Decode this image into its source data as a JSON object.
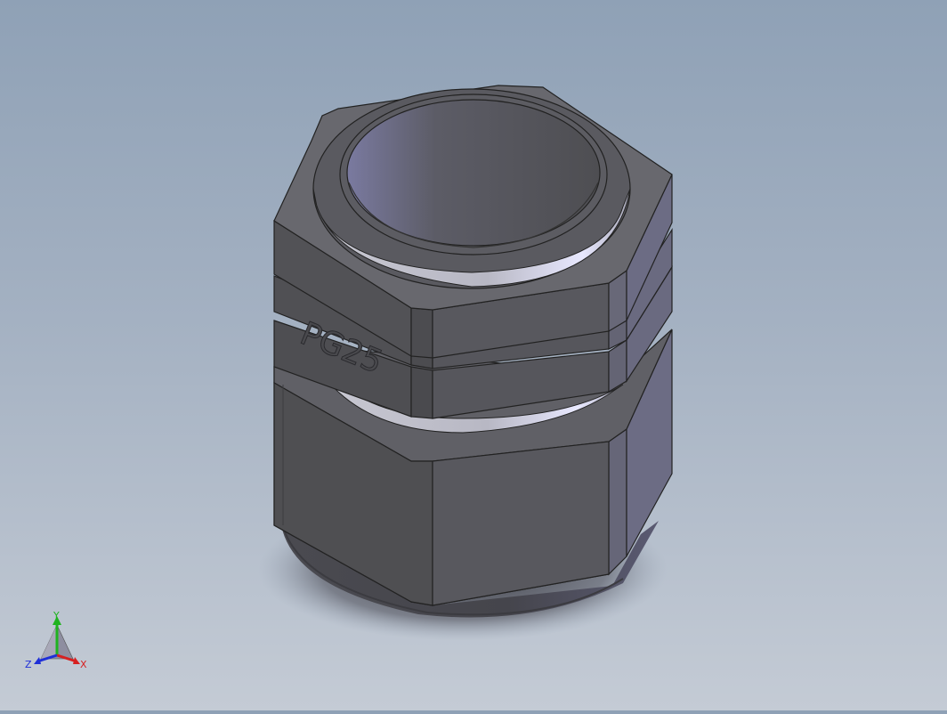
{
  "model": {
    "engraved_text": "PG25"
  },
  "triad": {
    "x_label": "X",
    "y_label": "Y",
    "z_label": "Z",
    "x_color": "#d62020",
    "y_color": "#1fb31f",
    "z_color": "#1e2fd8"
  },
  "colors": {
    "body_dark": "#555558",
    "body_light": "#6e6e78",
    "highlight": "#e6e6ff"
  }
}
